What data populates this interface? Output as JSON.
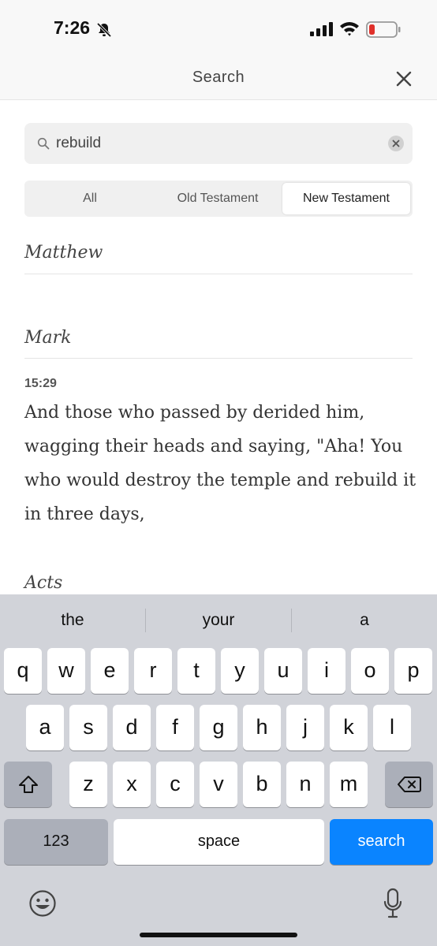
{
  "status": {
    "time": "7:26"
  },
  "nav": {
    "title": "Search"
  },
  "search": {
    "value": "rebuild"
  },
  "segments": [
    "All",
    "Old Testament",
    "New Testament"
  ],
  "results": {
    "books": [
      "Matthew",
      "Mark",
      "Acts"
    ],
    "verse_ref": "15:29",
    "verse_text": "And those who passed by derided him, wagging their heads and saying, \"Aha! You who would destroy the temple and rebuild it in three days,"
  },
  "keyboard": {
    "suggestions": [
      "the",
      "your",
      "a"
    ],
    "row1": [
      "q",
      "w",
      "e",
      "r",
      "t",
      "y",
      "u",
      "i",
      "o",
      "p"
    ],
    "row2": [
      "a",
      "s",
      "d",
      "f",
      "g",
      "h",
      "j",
      "k",
      "l"
    ],
    "row3": [
      "z",
      "x",
      "c",
      "v",
      "b",
      "n",
      "m"
    ],
    "numbers_label": "123",
    "space_label": "space",
    "action_label": "search"
  },
  "colors": {
    "accent": "#0a84ff",
    "battery_low": "#e0302a"
  }
}
